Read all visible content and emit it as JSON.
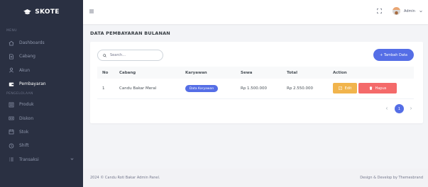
{
  "brand": {
    "name": "SKOTE"
  },
  "sidebar": {
    "section_menu": "MENU",
    "section_pengelolaan": "PENGELOLAAN",
    "items": [
      {
        "label": "Dashboards",
        "icon": "home-icon"
      },
      {
        "label": "Cabang",
        "icon": "document-icon"
      },
      {
        "label": "Akun",
        "icon": "user-icon"
      },
      {
        "label": "Pembayaran",
        "icon": "wallet-icon",
        "active": true
      },
      {
        "label": "Produk",
        "icon": "list-icon"
      },
      {
        "label": "Diskon",
        "icon": "discount-icon"
      },
      {
        "label": "Stok",
        "icon": "calendar-icon"
      },
      {
        "label": "Shift",
        "icon": "clock-icon"
      },
      {
        "label": "Transaksi",
        "icon": "list-icon"
      }
    ]
  },
  "topbar": {
    "username": "Admin"
  },
  "page": {
    "title": "DATA PEMBAYARAN BULANAN"
  },
  "search": {
    "placeholder": "Search..."
  },
  "actions": {
    "add_label": "+ Tambah Data"
  },
  "table": {
    "headers": [
      "No",
      "Cabang",
      "Karyawan",
      "Sewa",
      "Total",
      "Action"
    ],
    "rows": [
      {
        "no": "1",
        "cabang": "Candu Bakar Meral",
        "karyawan_button": "Data Karyawan",
        "sewa": "Rp 1.500.000",
        "total": "Rp 2.550.000",
        "edit_label": "Edit",
        "delete_label": "Hapus"
      }
    ]
  },
  "pagination": {
    "current": "1"
  },
  "footer": {
    "left": "2024 © Candu Roti Bakar Admin Panel.",
    "right": "Design & Develop by Themesbrand"
  },
  "colors": {
    "sidebar_bg": "#2a3042",
    "primary": "#556ee6",
    "warning": "#f1b44c",
    "danger": "#f46a6a"
  }
}
